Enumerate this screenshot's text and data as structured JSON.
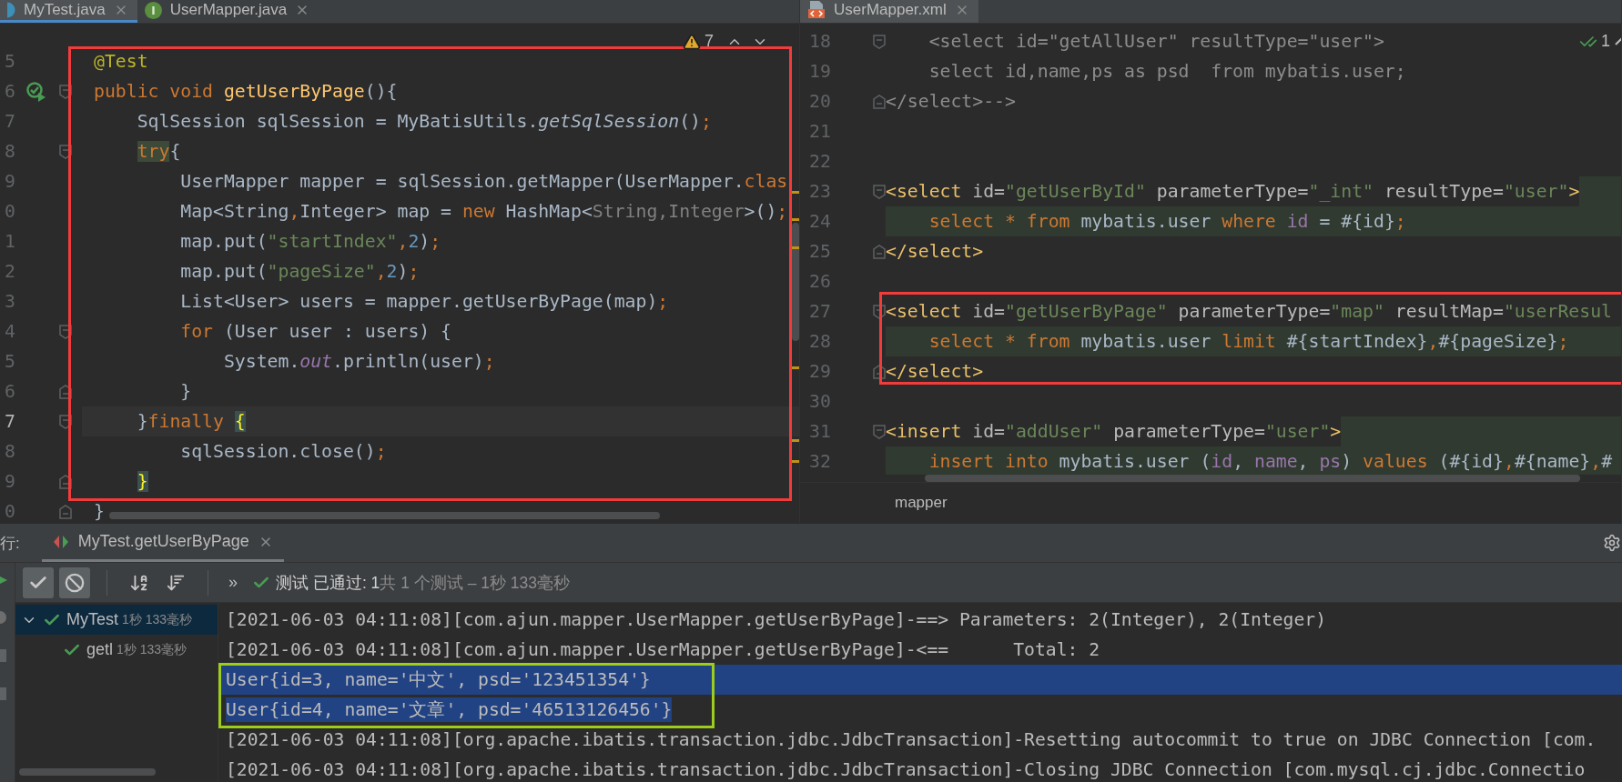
{
  "left_editor": {
    "active": true,
    "tabs": [
      {
        "label": "MyTest.java",
        "kind": "class",
        "selected": true
      },
      {
        "label": "UserMapper.java",
        "kind": "interface",
        "icon_letter": "I",
        "selected": false
      }
    ],
    "inspection": {
      "kind": "warning",
      "count": "7"
    },
    "blocks": [
      {
        "framed": true,
        "color": "#f23b3b",
        "lines": [
          {
            "number": "5",
            "runnable": false,
            "fold_start": false,
            "fold_end": false,
            "current": false,
            "tokens": [
              {
                "kind": "annotation",
                "text": "@Test"
              }
            ]
          },
          {
            "number": "6",
            "runnable": true,
            "fold_start": true,
            "fold_end": false,
            "current": false,
            "tokens": [
              {
                "kind": "keyword",
                "text": "public void "
              },
              {
                "kind": "method_decl",
                "text": "getUserByPage"
              },
              {
                "kind": "plain",
                "text": "(){"
              }
            ]
          },
          {
            "number": "7",
            "runnable": false,
            "fold_start": false,
            "fold_end": false,
            "current": false,
            "tokens": [
              {
                "kind": "plain",
                "text": "    SqlSession sqlSession = MyBatisUtils."
              },
              {
                "kind": "static_call",
                "text": "getSqlSession"
              },
              {
                "kind": "plain",
                "text": "()"
              },
              {
                "kind": "keyword",
                "text": ";"
              }
            ]
          },
          {
            "number": "8",
            "runnable": false,
            "fold_start": true,
            "fold_end": false,
            "current": false,
            "tokens": [
              {
                "kind": "marked_keyword",
                "text": "    try"
              },
              {
                "kind": "plain",
                "text": "{"
              }
            ]
          },
          {
            "number": "9",
            "runnable": false,
            "fold_start": false,
            "fold_end": false,
            "current": false,
            "tokens": [
              {
                "kind": "plain",
                "text": "        UserMapper mapper = sqlSession.getMapper(UserMapper."
              },
              {
                "kind": "keyword",
                "text": "clas"
              }
            ]
          },
          {
            "number": "0",
            "runnable": false,
            "fold_start": false,
            "fold_end": false,
            "current": false,
            "tokens": [
              {
                "kind": "plain",
                "text": "        Map<String"
              },
              {
                "kind": "keyword",
                "text": ","
              },
              {
                "kind": "plain",
                "text": "Integer> map = "
              },
              {
                "kind": "keyword",
                "text": "new "
              },
              {
                "kind": "plain",
                "text": "HashMap<"
              },
              {
                "kind": "generic",
                "text": "String,Integer"
              },
              {
                "kind": "plain",
                "text": ">()"
              },
              {
                "kind": "keyword",
                "text": ";"
              }
            ]
          },
          {
            "number": "1",
            "runnable": false,
            "fold_start": false,
            "fold_end": false,
            "current": false,
            "tokens": [
              {
                "kind": "plain",
                "text": "        map.put("
              },
              {
                "kind": "string",
                "text": "\"startIndex\""
              },
              {
                "kind": "keyword",
                "text": ","
              },
              {
                "kind": "number",
                "text": "2"
              },
              {
                "kind": "plain",
                "text": ")"
              },
              {
                "kind": "keyword",
                "text": ";"
              }
            ]
          },
          {
            "number": "2",
            "runnable": false,
            "fold_start": false,
            "fold_end": false,
            "current": false,
            "tokens": [
              {
                "kind": "plain",
                "text": "        map.put("
              },
              {
                "kind": "string",
                "text": "\"pageSize\""
              },
              {
                "kind": "keyword",
                "text": ","
              },
              {
                "kind": "number",
                "text": "2"
              },
              {
                "kind": "plain",
                "text": ")"
              },
              {
                "kind": "keyword",
                "text": ";"
              }
            ]
          },
          {
            "number": "3",
            "runnable": false,
            "fold_start": false,
            "fold_end": false,
            "current": false,
            "tokens": [
              {
                "kind": "plain",
                "text": "        List<User> users = mapper.getUserByPage(map)"
              },
              {
                "kind": "keyword",
                "text": ";"
              }
            ]
          },
          {
            "number": "4",
            "runnable": false,
            "fold_start": true,
            "fold_end": false,
            "current": false,
            "tokens": [
              {
                "kind": "keyword",
                "text": "        for"
              },
              {
                "kind": "plain",
                "text": " (User user : users) {"
              }
            ]
          },
          {
            "number": "5",
            "runnable": false,
            "fold_start": false,
            "fold_end": false,
            "current": false,
            "tokens": [
              {
                "kind": "plain",
                "text": "            System."
              },
              {
                "kind": "static_field",
                "text": "out"
              },
              {
                "kind": "plain",
                "text": ".println(user)"
              },
              {
                "kind": "keyword",
                "text": ";"
              }
            ]
          },
          {
            "number": "6",
            "runnable": false,
            "fold_start": false,
            "fold_end": true,
            "current": false,
            "tokens": [
              {
                "kind": "plain",
                "text": "        }"
              }
            ]
          },
          {
            "number": "7",
            "runnable": false,
            "fold_start": true,
            "fold_end": false,
            "current": true,
            "tokens": [
              {
                "kind": "plain",
                "text": "    }"
              },
              {
                "kind": "keyword",
                "text": "finally "
              },
              {
                "kind": "brace_match",
                "text": "{"
              }
            ]
          },
          {
            "number": "8",
            "runnable": false,
            "fold_start": false,
            "fold_end": false,
            "current": false,
            "tokens": [
              {
                "kind": "plain",
                "text": "        sqlSession.close()"
              },
              {
                "kind": "keyword",
                "text": ";"
              }
            ]
          },
          {
            "number": "9",
            "runnable": false,
            "fold_start": false,
            "fold_end": true,
            "current": false,
            "tokens": [
              {
                "kind": "brace_match",
                "text": "    }"
              }
            ]
          }
        ]
      },
      {
        "framed": false,
        "lines": [
          {
            "number": "0",
            "runnable": false,
            "fold_start": false,
            "fold_end": true,
            "current": false,
            "tokens": [
              {
                "kind": "plain",
                "text": "}"
              }
            ]
          }
        ]
      }
    ]
  },
  "right_editor": {
    "active": false,
    "tabs": [
      {
        "label": "UserMapper.xml",
        "kind": "xml",
        "selected": true
      }
    ],
    "inspection": {
      "kind": "ok",
      "count": "1"
    },
    "blocks": [
      {
        "framed": false,
        "lines": [
          {
            "number": "18",
            "fold_start": true,
            "fold_end": false,
            "highlighted": false,
            "tail_highlighted": false,
            "tokens": [
              {
                "kind": "comment",
                "text": "    <select id=\"getAllUser\" resultType=\"user\">"
              }
            ]
          },
          {
            "number": "19",
            "fold_start": false,
            "fold_end": false,
            "highlighted": false,
            "tail_highlighted": false,
            "tokens": [
              {
                "kind": "comment",
                "text": "    select id,name,ps as psd  from mybatis.user;"
              }
            ]
          },
          {
            "number": "20",
            "fold_start": false,
            "fold_end": true,
            "highlighted": false,
            "tail_highlighted": false,
            "tokens": [
              {
                "kind": "comment",
                "text": "</select>-->"
              }
            ]
          },
          {
            "number": "21",
            "fold_start": false,
            "fold_end": false,
            "highlighted": false,
            "tail_highlighted": false
          },
          {
            "number": "22",
            "fold_start": false,
            "fold_end": false,
            "highlighted": false,
            "tail_highlighted": false
          },
          {
            "number": "23",
            "fold_start": true,
            "fold_end": false,
            "highlighted": false,
            "tail_highlighted": true,
            "tokens": [
              {
                "kind": "tag",
                "text": "<select"
              },
              {
                "kind": "attr",
                "text": " id="
              },
              {
                "kind": "value",
                "text": "\"getUserById\""
              },
              {
                "kind": "attr",
                "text": " parameterType="
              },
              {
                "kind": "value",
                "text": "\"_int\""
              },
              {
                "kind": "attr",
                "text": " resultType="
              },
              {
                "kind": "value",
                "text": "\"user\""
              },
              {
                "kind": "tag",
                "text": ">"
              }
            ]
          },
          {
            "number": "24",
            "fold_start": false,
            "fold_end": false,
            "highlighted": true,
            "tail_highlighted": false,
            "tokens": [
              {
                "kind": "sql_keyword",
                "text": "    select * from"
              },
              {
                "kind": "plain",
                "text": " mybatis.user "
              },
              {
                "kind": "sql_keyword",
                "text": "where"
              },
              {
                "kind": "column",
                "text": " id"
              },
              {
                "kind": "plain",
                "text": " = #{id}"
              },
              {
                "kind": "sql_keyword",
                "text": ";"
              }
            ]
          },
          {
            "number": "25",
            "fold_start": false,
            "fold_end": true,
            "highlighted": false,
            "tail_highlighted": false,
            "tokens": [
              {
                "kind": "tag",
                "text": "</select>"
              }
            ]
          },
          {
            "number": "26",
            "fold_start": false,
            "fold_end": false,
            "highlighted": false,
            "tail_highlighted": false
          }
        ]
      },
      {
        "framed": true,
        "color": "#f23b3b",
        "lines": [
          {
            "number": "27",
            "fold_start": true,
            "fold_end": false,
            "highlighted": false,
            "tail_highlighted": false,
            "tokens": [
              {
                "kind": "tag",
                "text": "<select"
              },
              {
                "kind": "attr",
                "text": " id="
              },
              {
                "kind": "value",
                "text": "\"getUserByPage\""
              },
              {
                "kind": "attr",
                "text": " parameterType="
              },
              {
                "kind": "value",
                "text": "\"map\""
              },
              {
                "kind": "attr",
                "text": " resultMap="
              },
              {
                "kind": "value",
                "text": "\"userResul"
              }
            ]
          },
          {
            "number": "28",
            "fold_start": false,
            "fold_end": false,
            "highlighted": true,
            "tail_highlighted": false,
            "tokens": [
              {
                "kind": "sql_keyword",
                "text": "    select * from"
              },
              {
                "kind": "plain",
                "text": " mybatis.user "
              },
              {
                "kind": "sql_keyword",
                "text": "limit"
              },
              {
                "kind": "plain",
                "text": " #{startIndex}"
              },
              {
                "kind": "sql_keyword",
                "text": ","
              },
              {
                "kind": "plain",
                "text": "#{pageSize}"
              },
              {
                "kind": "sql_keyword",
                "text": ";"
              }
            ]
          },
          {
            "number": "29",
            "fold_start": false,
            "fold_end": true,
            "highlighted": false,
            "tail_highlighted": false,
            "tokens": [
              {
                "kind": "tag",
                "text": "</select>"
              }
            ]
          }
        ]
      },
      {
        "framed": false,
        "lines": [
          {
            "number": "30",
            "fold_start": false,
            "fold_end": false,
            "highlighted": false,
            "tail_highlighted": false
          },
          {
            "number": "31",
            "fold_start": true,
            "fold_end": false,
            "highlighted": false,
            "tail_highlighted": true,
            "tokens": [
              {
                "kind": "tag",
                "text": "<insert"
              },
              {
                "kind": "attr",
                "text": " id="
              },
              {
                "kind": "value",
                "text": "\"addUser\""
              },
              {
                "kind": "attr",
                "text": " parameterType="
              },
              {
                "kind": "value",
                "text": "\"user\""
              },
              {
                "kind": "tag",
                "text": ">"
              }
            ]
          },
          {
            "number": "32",
            "fold_start": false,
            "fold_end": false,
            "highlighted": true,
            "tail_highlighted": false,
            "tokens": [
              {
                "kind": "sql_keyword",
                "text": "    insert into"
              },
              {
                "kind": "plain",
                "text": " mybatis.user ("
              },
              {
                "kind": "column",
                "text": "id"
              },
              {
                "kind": "plain",
                "text": ", "
              },
              {
                "kind": "column",
                "text": "name"
              },
              {
                "kind": "plain",
                "text": ", "
              },
              {
                "kind": "column",
                "text": "ps"
              },
              {
                "kind": "plain",
                "text": ") "
              },
              {
                "kind": "sql_keyword",
                "text": "values"
              },
              {
                "kind": "plain",
                "text": " (#{id}"
              },
              {
                "kind": "sql_keyword",
                "text": ","
              },
              {
                "kind": "plain",
                "text": "#{name}"
              },
              {
                "kind": "sql_keyword",
                "text": ","
              },
              {
                "kind": "plain",
                "text": "#"
              }
            ]
          }
        ]
      }
    ],
    "breadcrumb": "mapper"
  },
  "run_panel": {
    "label": "行:",
    "tab": {
      "label": "MyTest.getUserByPage",
      "selected": true
    },
    "toolbar": [
      {
        "kind": "check",
        "selected": true
      },
      {
        "kind": "stop",
        "selected": true
      },
      {
        "kind": "sort_alpha",
        "selected": false
      },
      {
        "kind": "sort_duration",
        "selected": false
      }
    ],
    "more": "»",
    "status": {
      "passed": "测试 已通过: 1",
      "summary": "共 1 个测试 – 1秒 133毫秒"
    },
    "tree": [
      {
        "label": "MyTest",
        "time": "1秒 133毫秒",
        "selected": true,
        "expanded": true,
        "children": [
          {
            "label": "getl",
            "time": "1秒 133毫秒",
            "selected": false
          }
        ]
      }
    ],
    "console": [
      {
        "framed": false,
        "lines": [
          {
            "text": "[2021-06-03 04:11:08][com.ajun.mapper.UserMapper.getUserByPage]-==> Parameters: 2(Integer), 2(Integer)",
            "selected": false
          },
          {
            "text": "[2021-06-03 04:11:08][com.ajun.mapper.UserMapper.getUserByPage]-<==      Total: 2",
            "selected": false
          }
        ]
      },
      {
        "framed": true,
        "color": "#9ccc1c",
        "lines": [
          {
            "text": "User{id=3, name='中文', psd='123451354'}",
            "selected": true
          },
          {
            "text": "User{id=4, name='文章', psd='46513126456'}",
            "selected": true
          }
        ]
      },
      {
        "framed": false,
        "lines": [
          {
            "text": "[2021-06-03 04:11:08][org.apache.ibatis.transaction.jdbc.JdbcTransaction]-Resetting autocommit to true on JDBC Connection [com.",
            "selected": false
          },
          {
            "text": "[2021-06-03 04:11:08][org.apache.ibatis.transaction.jdbc.JdbcTransaction]-Closing JDBC Connection [com.mysql.cj.jdbc.Connectio",
            "selected": false
          }
        ]
      }
    ]
  }
}
